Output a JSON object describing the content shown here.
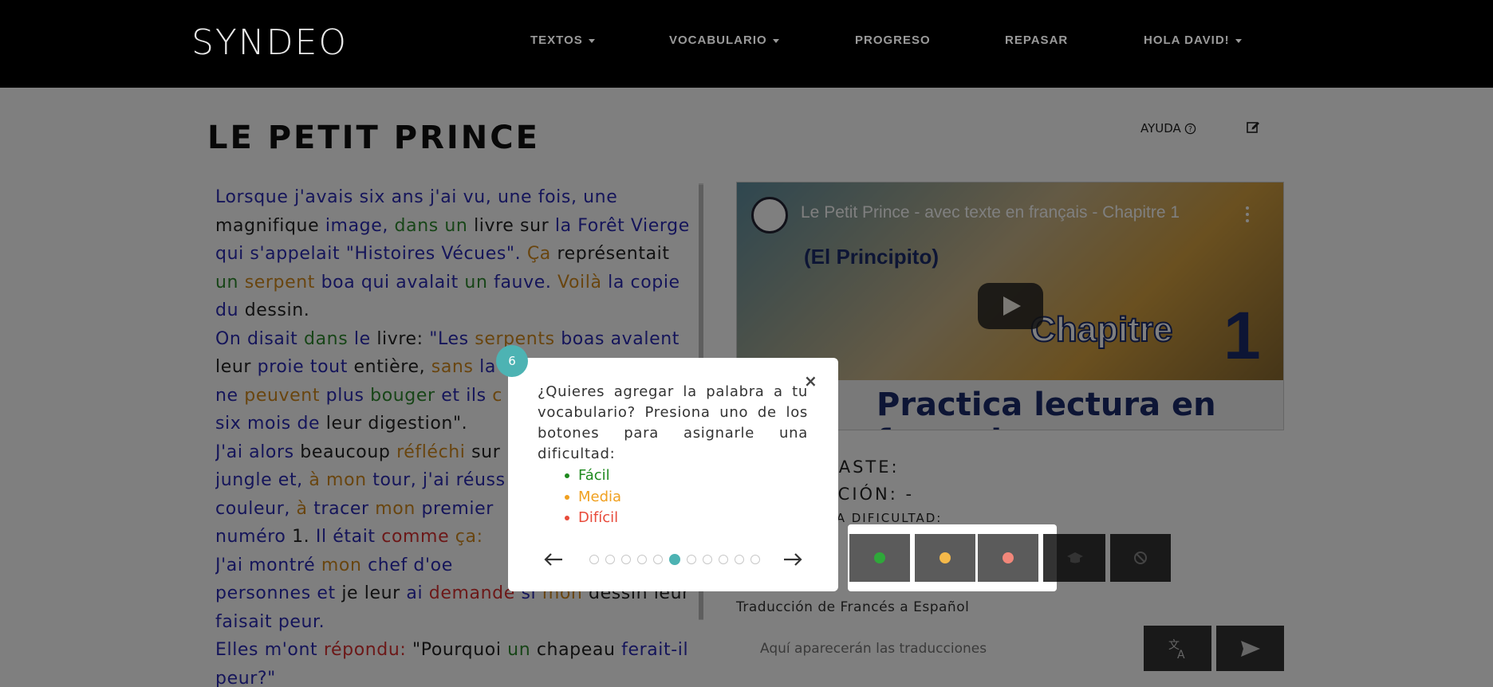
{
  "navbar": {
    "logo": "SYNDEO",
    "items": [
      {
        "label": "TEXTOS",
        "dropdown": true
      },
      {
        "label": "VOCABULARIO",
        "dropdown": true
      },
      {
        "label": "PROGRESO",
        "dropdown": false
      },
      {
        "label": "REPASAR",
        "dropdown": false
      },
      {
        "label": "HOLA DAVID!",
        "dropdown": true
      }
    ]
  },
  "page": {
    "title": "LE PETIT PRINCE",
    "help_label": "AYUDA"
  },
  "video": {
    "title": "Le Petit Prince - avec texte en français - Chapitre 1",
    "subtitle": "(El Principito)",
    "chapter_word": "Chapitre",
    "chapter_number": "1",
    "banner": "Practica lectura en français"
  },
  "info": {
    "line1": "NASTE:",
    "line2": "CCIÓN: -",
    "line3": "LA DIFICULTAD:"
  },
  "translation": {
    "label": "Traducción de Francés a Español",
    "placeholder": "Aquí aparecerán las traducciones"
  },
  "colors": {
    "easy": "#1f8a1f",
    "medium": "#f0a020",
    "hard": "#e84a3a",
    "accent": "#4db3b3"
  },
  "tour": {
    "step": "6",
    "close": "×",
    "text": "¿Quieres agregar la palabra a tu vocabulario? Presiona uno de los botones para asignarle una dificultad:",
    "legend": [
      "Fácil",
      "Media",
      "Difícil"
    ],
    "dots_total": 11,
    "dots_active": 5
  },
  "text_lines": [
    [
      [
        "b",
        "Lorsque j'avais six ans j'ai vu, une fois, une"
      ]
    ],
    [
      [
        "k",
        "magnifique "
      ],
      [
        "b",
        "image, "
      ],
      [
        "g",
        "dans un "
      ],
      [
        "k",
        "livre sur "
      ],
      [
        "b",
        "la Forêt Vierge"
      ]
    ],
    [
      [
        "b",
        "qui s'appelait \"Histoires Vécues\". "
      ],
      [
        "o",
        "Ça "
      ],
      [
        "k",
        "représentait"
      ]
    ],
    [
      [
        "g",
        "un "
      ],
      [
        "o",
        "serpent "
      ],
      [
        "b",
        "boa qui avalait "
      ],
      [
        "g",
        "un "
      ],
      [
        "b",
        "fauve. "
      ],
      [
        "o",
        "Voilà "
      ],
      [
        "b",
        "la copie"
      ]
    ],
    [
      [
        "b",
        "du "
      ],
      [
        "k",
        "dessin."
      ]
    ],
    [
      [
        "b",
        "On disait "
      ],
      [
        "g",
        "dans "
      ],
      [
        "b",
        "le "
      ],
      [
        "k",
        "livre: "
      ],
      [
        "b",
        "\"Les "
      ],
      [
        "o",
        "serpents "
      ],
      [
        "b",
        "boas avalent"
      ]
    ],
    [
      [
        "k",
        "leur "
      ],
      [
        "b",
        "proie tout "
      ],
      [
        "k",
        "entière, "
      ],
      [
        "o",
        "sans "
      ],
      [
        "b",
        "la"
      ]
    ],
    [
      [
        "b",
        "ne "
      ],
      [
        "o",
        "peuvent "
      ],
      [
        "b",
        "plus "
      ],
      [
        "g",
        "bouger "
      ],
      [
        "b",
        "et ils "
      ],
      [
        "o",
        "c"
      ]
    ],
    [
      [
        "b",
        "six mois de "
      ],
      [
        "k",
        "leur digestion\"."
      ]
    ],
    [
      [
        "b",
        "J'ai alors "
      ],
      [
        "k",
        "beaucoup "
      ],
      [
        "o",
        "réfléchi "
      ],
      [
        "k",
        "sur"
      ]
    ],
    [
      [
        "b",
        "jungle et, "
      ],
      [
        "o",
        "à mon "
      ],
      [
        "b",
        "tour, j'ai réuss"
      ]
    ],
    [
      [
        "b",
        "couleur, "
      ],
      [
        "o",
        "à "
      ],
      [
        "b",
        "tracer "
      ],
      [
        "o",
        "mon "
      ],
      [
        "b",
        "premier"
      ]
    ],
    [
      [
        "b",
        "numéro "
      ],
      [
        "k",
        "1. "
      ],
      [
        "b",
        "Il était "
      ],
      [
        "r",
        "comme "
      ],
      [
        "o",
        "ça:"
      ]
    ],
    [
      [
        "b",
        "J'ai montré "
      ],
      [
        "o",
        "mon "
      ],
      [
        "b",
        "chef d'oe"
      ]
    ],
    [
      [
        "b",
        "personnes et "
      ],
      [
        "k",
        "je leur "
      ],
      [
        "b",
        "ai "
      ],
      [
        "r",
        "demande "
      ],
      [
        "b",
        "si "
      ],
      [
        "o",
        "mon "
      ],
      [
        "k",
        "dessin leur"
      ]
    ],
    [
      [
        "b",
        "faisait peur."
      ]
    ],
    [
      [
        "b",
        "Elles m'ont "
      ],
      [
        "r",
        "répondu: "
      ],
      [
        "k",
        "\"Pourquoi "
      ],
      [
        "g",
        "un "
      ],
      [
        "k",
        "chapeau "
      ],
      [
        "b",
        "ferait-il"
      ]
    ],
    [
      [
        "b",
        "peur?\""
      ]
    ]
  ]
}
